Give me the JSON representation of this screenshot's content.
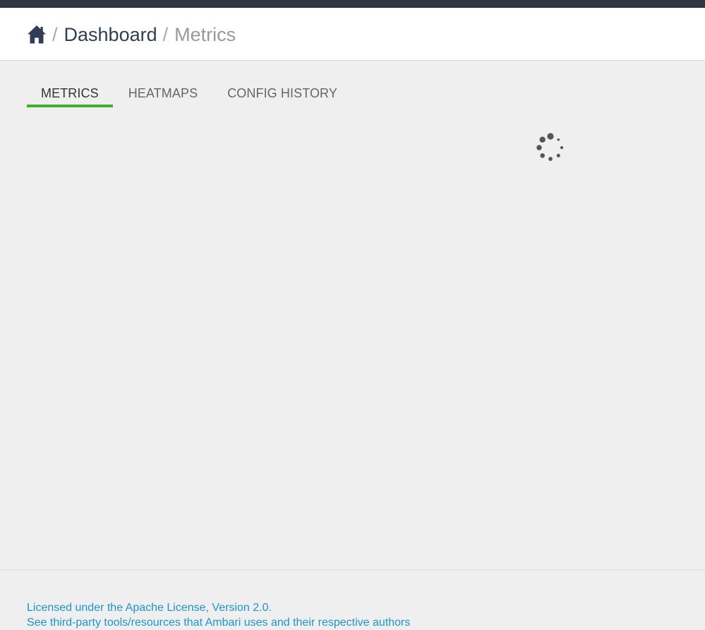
{
  "breadcrumb": {
    "home_icon": "home-icon",
    "separator": "/",
    "dashboard": "Dashboard",
    "current": "Metrics"
  },
  "tabs": [
    {
      "label": "METRICS",
      "active": true
    },
    {
      "label": "HEATMAPS",
      "active": false
    },
    {
      "label": "CONFIG HISTORY",
      "active": false
    }
  ],
  "spinner": {
    "icon": "loading-spinner-icon"
  },
  "footer": {
    "license": "Licensed under the Apache License, Version 2.0.",
    "third_party": "See third-party tools/resources that Ambari uses and their respective authors"
  },
  "colors": {
    "topbar": "#313740",
    "header_bg": "#ffffff",
    "page_bg": "#efefef",
    "breadcrumb_link": "#313d54",
    "breadcrumb_current": "#999999",
    "tab_active_underline": "#3fae2a",
    "footer_link": "#1e94cf"
  }
}
